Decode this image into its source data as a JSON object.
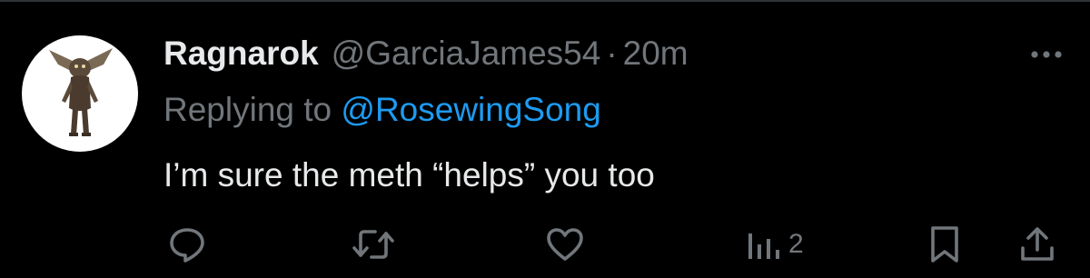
{
  "tweet": {
    "display_name": "Ragnarok",
    "handle": "@GarciaJames54",
    "separator": "·",
    "time": "20m",
    "replying_prefix": "Replying to ",
    "replying_to": "@RosewingSong",
    "text": "I’m sure the meth “helps” you too"
  },
  "actions": {
    "reply_icon": "reply-icon",
    "retweet_icon": "retweet-icon",
    "like_icon": "heart-icon",
    "views_icon": "views-icon",
    "views_count": "2",
    "bookmark_icon": "bookmark-icon",
    "share_icon": "share-icon"
  },
  "colors": {
    "background": "#000000",
    "text_primary": "#e7e9ea",
    "text_secondary": "#71767b",
    "accent": "#1d9bf0"
  }
}
